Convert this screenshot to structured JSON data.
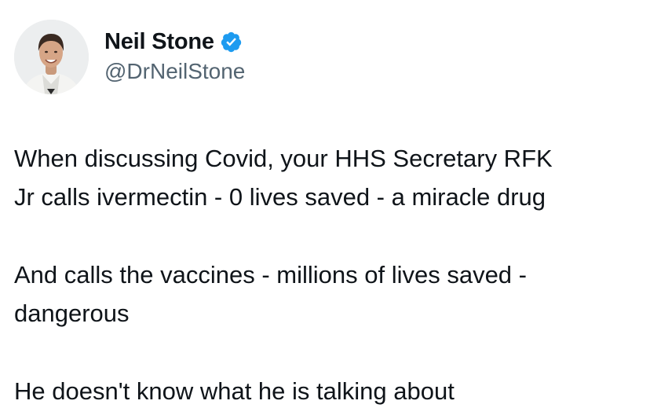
{
  "author": {
    "display_name": "Neil Stone",
    "handle": "@DrNeilStone",
    "verified_icon": "verified-badge-icon",
    "verified_color": "#1d9bf0"
  },
  "tweet": {
    "paragraphs": [
      {
        "lines": [
          "When discussing Covid, your HHS Secretary RFK",
          "Jr calls ivermectin - 0 lives saved - a miracle drug"
        ]
      },
      {
        "lines": [
          "And calls the vaccines - millions of lives saved -",
          "dangerous"
        ]
      },
      {
        "lines": [
          "He doesn't know what he is talking about"
        ]
      }
    ]
  }
}
